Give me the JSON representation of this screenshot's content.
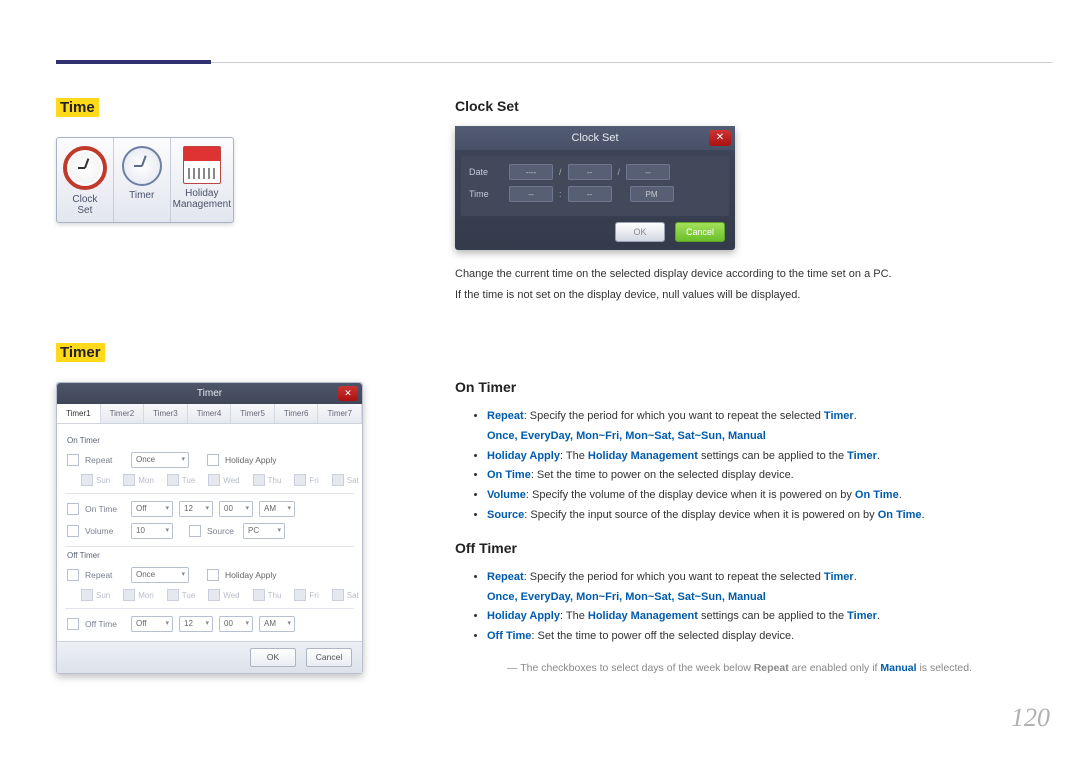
{
  "headings": {
    "time": "Time",
    "timer": "Timer",
    "clockset": "Clock Set",
    "ontimer": "On Timer",
    "offtimer": "Off Timer"
  },
  "time_panel": [
    {
      "label": "Clock\nSet"
    },
    {
      "label": "Timer"
    },
    {
      "label": "Holiday\nManagement"
    }
  ],
  "clockset_dlg": {
    "title": "Clock Set",
    "close": "✕",
    "date_label": "Date",
    "time_label": "Time",
    "pm": "PM",
    "dash": "----",
    "dash2": "--",
    "slash": "/",
    "colon": ":",
    "ok": "OK",
    "cancel": "Cancel"
  },
  "clockset_desc": [
    "Change the current time on the selected display device according to the time set on a PC.",
    "If the time is not set on the display device, null values will be displayed."
  ],
  "timer_dlg": {
    "title": "Timer",
    "close": "✕",
    "tabs": [
      "Timer1",
      "Timer2",
      "Timer3",
      "Timer4",
      "Timer5",
      "Timer6",
      "Timer7"
    ],
    "on_section": "On Timer",
    "off_section": "Off Timer",
    "repeat": "Repeat",
    "once": "Once",
    "holiday": "Holiday Apply",
    "ontime": "On Time",
    "offtime": "Off Time",
    "volume": "Volume",
    "source": "Source",
    "off": "Off",
    "hr": "12",
    "min": "00",
    "ampm": "AM",
    "vol": "10",
    "pc": "PC",
    "days": [
      "Sun",
      "Mon",
      "Tue",
      "Wed",
      "Thu",
      "Fri",
      "Sat"
    ],
    "ok": "OK",
    "cancel": "Cancel"
  },
  "ontimer_bullets": {
    "b1_pre": "Repeat",
    "b1_mid": ": Specify the period for which you want to repeat the selected ",
    "b1_end": "Timer",
    "options": "Once, EveryDay, Mon~Fri, Mon~Sat, Sat~Sun, Manual",
    "b2_a": "Holiday Apply",
    "b2_b": ": The ",
    "b2_c": "Holiday Management",
    "b2_d": " settings can be applied to the ",
    "b2_e": "Timer",
    "b3_a": "On Time",
    "b3_b": ": Set the time to power on the selected display device.",
    "b4_a": "Volume",
    "b4_b": ": Specify the volume of the display device when it is powered on by ",
    "b4_c": "On Time",
    "b5_a": "Source",
    "b5_b": ": Specify the input source of the display device when it is powered on by ",
    "b5_c": "On Time"
  },
  "offtimer_bullets": {
    "b3_a": "Off Time",
    "b3_b": ": Set the time to power off the selected display device."
  },
  "note_a": "The checkboxes to select days of the week below ",
  "note_b": "Repeat",
  "note_c": " are enabled only if ",
  "note_d": "Manual",
  "note_e": " is selected.",
  "page": "120"
}
